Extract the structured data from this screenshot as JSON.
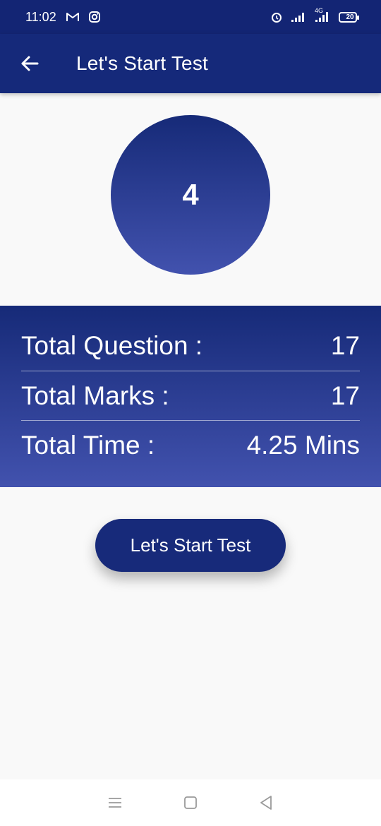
{
  "status_bar": {
    "time": "11:02",
    "network": "4G",
    "battery": "20",
    "icons": [
      "gmail-icon",
      "instagram-icon",
      "alarm-icon",
      "signal-icon",
      "signal-4g-icon",
      "battery-icon"
    ]
  },
  "app_bar": {
    "title": "Let's Start Test",
    "back_icon": "back-arrow-icon"
  },
  "set_number": "4",
  "summary": {
    "rows": [
      {
        "label": "Total Question :",
        "value": "17"
      },
      {
        "label": "Total Marks :",
        "value": "17"
      },
      {
        "label": "Total Time :",
        "value": "4.25 Mins"
      }
    ]
  },
  "start_button": {
    "label": "Let's Start Test"
  },
  "nav_bar": {
    "icons": [
      "menu-icon",
      "home-icon",
      "back-triangle-icon"
    ]
  },
  "colors": {
    "primary": "#15297a",
    "gradient_top": "#162a78",
    "gradient_bottom": "#4252ae",
    "background": "#f9f9f9"
  }
}
